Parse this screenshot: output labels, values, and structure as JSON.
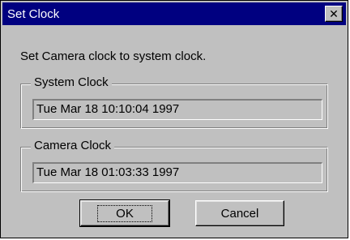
{
  "window": {
    "title": "Set Clock",
    "close_label": "✕"
  },
  "message": "Set Camera clock to system clock.",
  "system_clock": {
    "label": "System Clock",
    "value": "Tue Mar 18 10:10:04 1997"
  },
  "camera_clock": {
    "label": "Camera Clock",
    "value": "Tue Mar 18 01:03:33 1997"
  },
  "buttons": {
    "ok": "OK",
    "cancel": "Cancel"
  }
}
